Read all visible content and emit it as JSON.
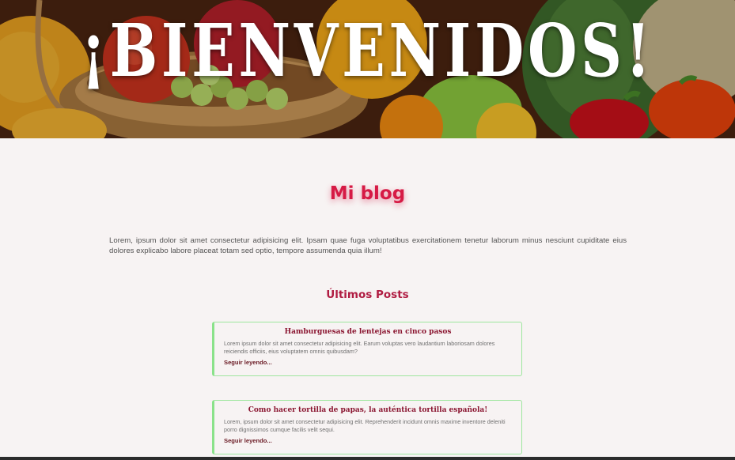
{
  "hero": {
    "title": "¡BIENVENIDOS!"
  },
  "blog": {
    "title": "Mi blog",
    "intro": "Lorem, ipsum dolor sit amet consectetur adipisicing elit. Ipsam quae fuga voluptatibus exercitationem tenetur laborum minus nesciunt cupiditate eius dolores explicabo labore placeat totam sed optio, tempore assumenda quia illum!"
  },
  "posts": {
    "heading": "Últimos Posts",
    "items": [
      {
        "title": "Hamburguesas de lentejas en cinco pasos",
        "excerpt": "Lorem ipsum dolor sit amet consectetur adipisicing elit. Earum voluptas vero laudantium laboriosam dolores reiciendis officiis, eius voluptatem omnis quibusdam?",
        "link": "Seguir leyendo..."
      },
      {
        "title": "Como hacer tortilla de papas, la auténtica tortilla española!",
        "excerpt": "Lorem, ipsum dolor sit amet consectetur adipisicing elit. Reprehenderit incidunt omnis maxime inventore deleniti porro dignissimos cumque facilis velit sequi.",
        "link": "Seguir leyendo..."
      }
    ]
  },
  "colors": {
    "accent": "#d61a45",
    "post_title": "#8a1530",
    "card_border": "#9ee69e",
    "background": "#f7f3f3"
  }
}
